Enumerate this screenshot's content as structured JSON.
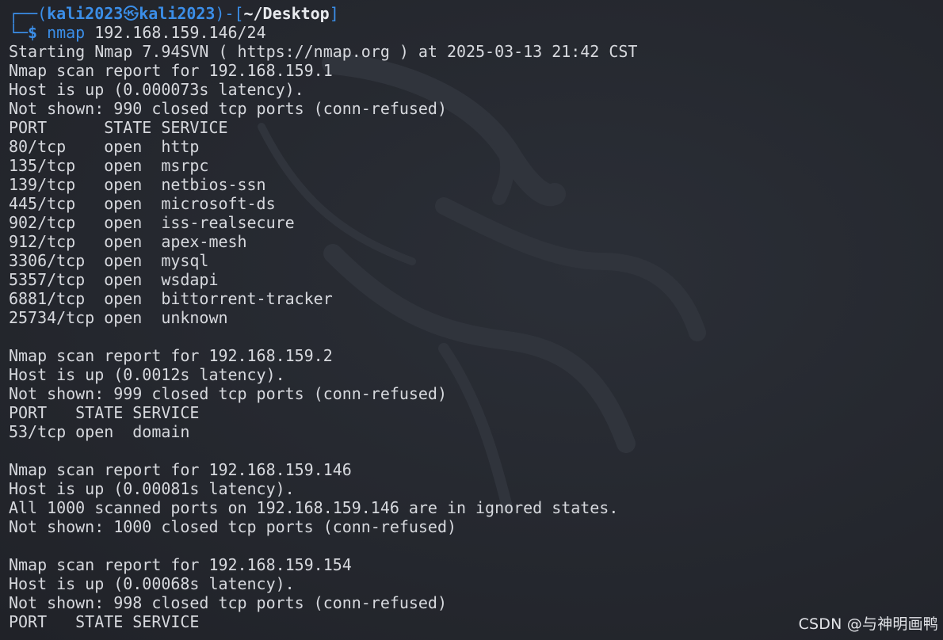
{
  "prompt": {
    "frame_top": "┌──(",
    "user": "kali2023",
    "at_icon": "㉿",
    "host": "kali2023",
    "mid": ")-[",
    "dir": "~/Desktop",
    "end": "]",
    "frame_bottom": "└─",
    "dollar": "$",
    "command": "nmap",
    "args": " 192.168.159.146/24"
  },
  "output_lines": [
    "Starting Nmap 7.94SVN ( https://nmap.org ) at 2025-03-13 21:42 CST",
    "Nmap scan report for 192.168.159.1",
    "Host is up (0.000073s latency).",
    "Not shown: 990 closed tcp ports (conn-refused)",
    "PORT      STATE SERVICE",
    "80/tcp    open  http",
    "135/tcp   open  msrpc",
    "139/tcp   open  netbios-ssn",
    "445/tcp   open  microsoft-ds",
    "902/tcp   open  iss-realsecure",
    "912/tcp   open  apex-mesh",
    "3306/tcp  open  mysql",
    "5357/tcp  open  wsdapi",
    "6881/tcp  open  bittorrent-tracker",
    "25734/tcp open  unknown",
    "",
    "Nmap scan report for 192.168.159.2",
    "Host is up (0.0012s latency).",
    "Not shown: 999 closed tcp ports (conn-refused)",
    "PORT   STATE SERVICE",
    "53/tcp open  domain",
    "",
    "Nmap scan report for 192.168.159.146",
    "Host is up (0.00081s latency).",
    "All 1000 scanned ports on 192.168.159.146 are in ignored states.",
    "Not shown: 1000 closed tcp ports (conn-refused)",
    "",
    "Nmap scan report for 192.168.159.154",
    "Host is up (0.00068s latency).",
    "Not shown: 998 closed tcp ports (conn-refused)",
    "PORT   STATE SERVICE"
  ],
  "watermark": "CSDN @与神明画鸭",
  "colors": {
    "background": "#262930",
    "text": "#d7d9de",
    "prompt_accent": "#3b8ee8"
  },
  "icons": {
    "background_logo": "kali-dragon-logo"
  }
}
